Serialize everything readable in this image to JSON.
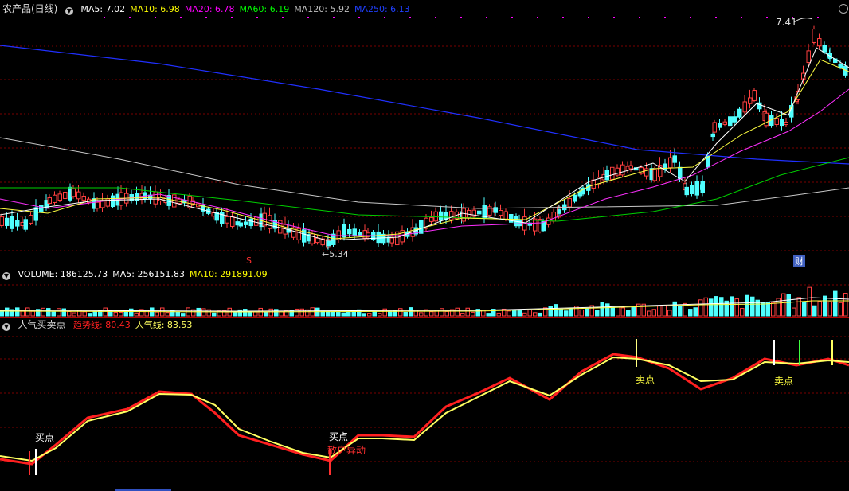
{
  "main_panel": {
    "title": "农产品(日线)",
    "ma": [
      {
        "label": "MA5:",
        "value": "7.02",
        "color": "#ffffff"
      },
      {
        "label": "MA10:",
        "value": "6.98",
        "color": "#ffff00"
      },
      {
        "label": "MA20:",
        "value": "6.78",
        "color": "#ff00ff"
      },
      {
        "label": "MA60:",
        "value": "6.19",
        "color": "#00ff00"
      },
      {
        "label": "MA120:",
        "value": "5.92",
        "color": "#c0c0c0"
      },
      {
        "label": "MA250:",
        "value": "6.13",
        "color": "#2040ff"
      }
    ],
    "high_label": "7.41",
    "low_label": "←5.34",
    "s_mark": "S",
    "cai_mark": "财"
  },
  "volume_panel": {
    "items": [
      {
        "label": "VOLUME:",
        "value": "186125.73",
        "color": "#ffffff"
      },
      {
        "label": "MA5:",
        "value": "256151.83",
        "color": "#ffffff"
      },
      {
        "label": "MA10:",
        "value": "291891.09",
        "color": "#ffff00"
      }
    ]
  },
  "indicator_panel": {
    "title": "人气买卖点",
    "items": [
      {
        "label": "趋势线:",
        "value": "80.43",
        "color": "#ff2020"
      },
      {
        "label": "人气线:",
        "value": "83.53",
        "color": "#ffff60"
      }
    ],
    "annotations": {
      "buy1": "买点",
      "buy2": "买点",
      "buy2_sub": "散户异动",
      "sell1": "卖点",
      "sell2": "卖点"
    }
  }
}
